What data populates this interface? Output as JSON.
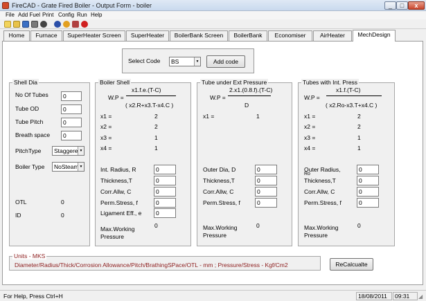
{
  "window": {
    "title": "FireCAD - Grate Fired Boiler - Output Form - boiler",
    "minimize": "_",
    "maximize": "□",
    "close": "x"
  },
  "menu": [
    "File",
    "Add Fuel",
    "Print",
    "Config",
    "Run",
    "Help"
  ],
  "toolbar": {
    "icons": [
      {
        "name": "new-file-icon",
        "color": "#f2d35b"
      },
      {
        "name": "open-folder-icon",
        "color": "#e8c24a"
      },
      {
        "name": "save-icon",
        "color": "#3a6fc4"
      },
      {
        "name": "print-icon",
        "color": "#7a7a7a"
      },
      {
        "name": "gear-icon",
        "color": "#444444"
      },
      {
        "name": "run-icon",
        "color": "#2b4fa8"
      },
      {
        "name": "help-icon",
        "color": "#e3a020"
      },
      {
        "name": "export-icon",
        "color": "#b04040"
      },
      {
        "name": "stop-icon",
        "color": "#d02020"
      }
    ]
  },
  "tabs": [
    "Home",
    "Furnace",
    "SuperHeater Screen",
    "SuperHeater",
    "BoilerBank Screen",
    "BoilerBank",
    "Economiser",
    "AirHeater",
    "MechDesign"
  ],
  "select_code": {
    "label": "Select Code",
    "value": "BS",
    "add_button": "Add code"
  },
  "shell_dia": {
    "title": "Shell Dia",
    "no_of_tubes_label": "No Of Tubes",
    "no_of_tubes": "0",
    "tube_od_label": "Tube OD",
    "tube_od": "0",
    "tube_pitch_label": "Tube Pitch",
    "tube_pitch": "0",
    "breath_space_label": "Breath space",
    "breath_space": "0",
    "pitch_type_label": "PitchType",
    "pitch_type": "Staggere",
    "boiler_type_label": "Boiler Type",
    "boiler_type": "NoSteam",
    "otl_label": "OTL",
    "otl": "0",
    "id_label": "ID",
    "id": "0"
  },
  "boiler_shell": {
    "title": "Boiler Shell",
    "formula_lhs": "W.P =",
    "formula_num": "x1.f.e.(T-C)",
    "formula_den": "( x2.R+x3.T-x4.C )",
    "x1_label": "x1 =",
    "x1": "2",
    "x2_label": "x2 =",
    "x2": "2",
    "x3_label": "x3 =",
    "x3": "1",
    "x4_label": "x4 =",
    "x4": "1",
    "radius_label": "Int. Radius, R",
    "radius": "0",
    "thickness_label": "Thickness,T",
    "thickness": "0",
    "corr_label": "Corr.Allw, C",
    "corr": "0",
    "stress_label": "Perm.Stress, f",
    "stress": "0",
    "lig_label": "Ligament Eff., e",
    "lig": "0",
    "mwp_label_1": "Max.Working",
    "mwp_label_2": "Pressure",
    "mwp": "0"
  },
  "tube_ext": {
    "title": "Tube under Ext Pressure",
    "formula_lhs": "W.P =",
    "formula_num": "2.x1.(0.8.f).(T-C)",
    "formula_den": "D",
    "x1_label": "x1 =",
    "x1": "1",
    "od_label": "Outer Dia, D",
    "od": "0",
    "thickness_label": "Thickness,T",
    "thickness": "0",
    "corr_label": "Corr.Allw, C",
    "corr": "0",
    "stress_label": "Perm.Stress, f",
    "stress": "0",
    "mwp_label_1": "Max.Working",
    "mwp_label_2": "Pressure",
    "mwp": "0"
  },
  "tube_int": {
    "title": "Tubes with Int. Press",
    "formula_lhs": "W.P =",
    "formula_num": "x1.f.(T-C)",
    "formula_den": "( x2.Ro-x3.T+x4.C )",
    "x1_label": "x1 =",
    "x1": "2",
    "x2_label": "x2 =",
    "x2": "2",
    "x3_label": "x3 =",
    "x3": "1",
    "x4_label": "x4 =",
    "x4": "1",
    "radius_label_1": "Outer Radius,",
    "radius_label_2": "Ro",
    "radius": "0",
    "thickness_label": "Thickness,T",
    "thickness": "0",
    "corr_label": "Corr.Allw, C",
    "corr": "0",
    "stress_label": "Perm.Stress, f",
    "stress": "0",
    "mwp_label_1": "Max.Working",
    "mwp_label_2": "Pressure",
    "mwp": "0"
  },
  "units": {
    "title": "Units - MKS",
    "text": "Diameter/Radius/Thick/Corrosion Allowance/Pitch/BrathingSPace/OTL - mm ; Pressure/Stress - Kgf/Cm2"
  },
  "recalc_button": "ReCalcualte",
  "status": {
    "help": "For Help, Press Ctrl+H",
    "date": "18/08/2011",
    "time": "09:31"
  }
}
